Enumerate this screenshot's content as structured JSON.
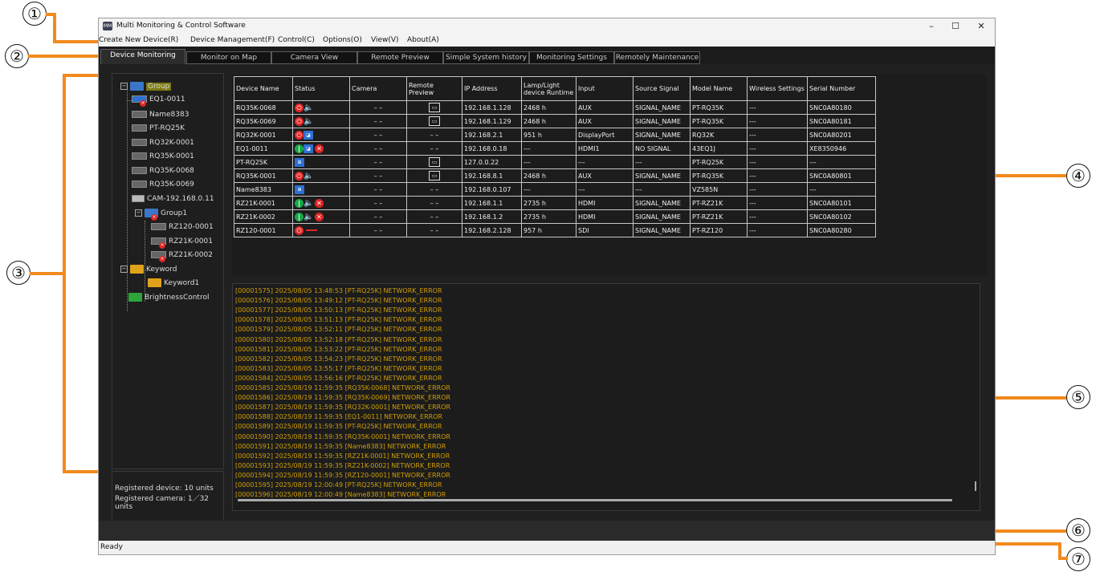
{
  "window": {
    "title": "Multi Monitoring & Control Software",
    "icon_text": "MM",
    "controls": [
      "–",
      "☐",
      "✕"
    ]
  },
  "menu": [
    "Create New Device(R)",
    "Device Management(F)",
    "Control(C)",
    "Options(O)",
    "View(V)",
    "About(A)"
  ],
  "tabs": [
    "Device Monitoring",
    "Monitor on Map",
    "Camera View",
    "Remote Preview",
    "Simple System history",
    "Monitoring Settings",
    "Remotely Maintenance"
  ],
  "callouts": [
    "①",
    "②",
    "③",
    "④",
    "⑤",
    "⑥",
    "⑦"
  ],
  "tree": {
    "root": "Group",
    "devices": [
      "EQ1-0011",
      "Name8383",
      "PT-RQ25K",
      "RQ32K-0001",
      "RQ35K-0001",
      "RQ35K-0068",
      "RQ35K-0069",
      "CAM-192.168.0.11"
    ],
    "group1": "Group1",
    "group1_devices": [
      "RZ120-0001",
      "RZ21K-0001",
      "RZ21K-0002"
    ],
    "keyword": "Keyword",
    "keyword1": "Keyword1",
    "brightness": "BrightnessControl"
  },
  "registration": {
    "line1": "Registered device: 10 units",
    "line2": "Registered camera: 1／32 units"
  },
  "table": {
    "headers": [
      "Device Name",
      "Status",
      "Camera",
      "Remote Preview",
      "IP Address",
      "Lamp/Light device Runtime",
      "Input",
      "Source Signal",
      "Model Name",
      "Wireless Settings",
      "Serial Number"
    ],
    "rows": [
      {
        "name": "RQ35K-0068",
        "status": "off-audio",
        "camera": "– –",
        "preview": true,
        "ip": "192.168.1.128",
        "runtime": "2468 h",
        "input": "AUX",
        "signal": "SIGNAL_NAME",
        "model": "PT-RQ35K",
        "wireless": "---",
        "serial": "SNC0A80180"
      },
      {
        "name": "RQ35K-0069",
        "status": "off-audio",
        "camera": "– –",
        "preview": true,
        "ip": "192.168.1.129",
        "runtime": "2468 h",
        "input": "AUX",
        "signal": "SIGNAL_NAME",
        "model": "PT-RQ35K",
        "wireless": "---",
        "serial": "SNC0A80181"
      },
      {
        "name": "RQ32K-0001",
        "status": "off-screen",
        "camera": "– –",
        "preview": false,
        "ip": "192.168.2.1",
        "runtime": "951 h",
        "input": "DisplayPort",
        "signal": "SIGNAL_NAME",
        "model": "RQ32K",
        "wireless": "---",
        "serial": "SNC0A80201"
      },
      {
        "name": "EQ1-0011",
        "status": "on-screen-error",
        "camera": "– –",
        "preview": false,
        "ip": "192.168.0.18",
        "runtime": "---",
        "input": "HDMI1",
        "signal": "NO SIGNAL",
        "model": "43EQ1J",
        "wireless": "---",
        "serial": "XE8350946"
      },
      {
        "name": "PT-RQ25K",
        "status": "network",
        "camera": "– –",
        "preview": true,
        "ip": "127.0.0.22",
        "runtime": "---",
        "input": "---",
        "signal": "---",
        "model": "PT-RQ25K",
        "wireless": "---",
        "serial": "---"
      },
      {
        "name": "RQ35K-0001",
        "status": "off-audio",
        "camera": "– –",
        "preview": true,
        "ip": "192.168.8.1",
        "runtime": "2468 h",
        "input": "AUX",
        "signal": "SIGNAL_NAME",
        "model": "PT-RQ35K",
        "wireless": "---",
        "serial": "SNC0A80801"
      },
      {
        "name": "Name8383",
        "status": "network",
        "camera": "– –",
        "preview": false,
        "ip": "192.168.0.107",
        "runtime": "---",
        "input": "---",
        "signal": "---",
        "model": "VZ585N",
        "wireless": "---",
        "serial": "---"
      },
      {
        "name": "RZ21K-0001",
        "status": "on-audio-error",
        "camera": "– –",
        "preview": false,
        "ip": "192.168.1.1",
        "runtime": "2735 h",
        "input": "HDMI",
        "signal": "SIGNAL_NAME",
        "model": "PT-RZ21K",
        "wireless": "---",
        "serial": "SNC0A80101"
      },
      {
        "name": "RZ21K-0002",
        "status": "on-audio-error",
        "camera": "– –",
        "preview": false,
        "ip": "192.168.1.2",
        "runtime": "2735 h",
        "input": "HDMI",
        "signal": "SIGNAL_NAME",
        "model": "PT-RZ21K",
        "wireless": "---",
        "serial": "SNC0A80102"
      },
      {
        "name": "RZ120-0001",
        "status": "off-dash",
        "camera": "– –",
        "preview": false,
        "ip": "192.168.2.128",
        "runtime": "957 h",
        "input": "SDI",
        "signal": "SIGNAL_NAME",
        "model": "PT-RZ120",
        "wireless": "---",
        "serial": "SNC0A80280"
      }
    ]
  },
  "log": [
    "[00001575] 2025/08/05 13:48:53 [PT-RQ25K] NETWORK_ERROR",
    "[00001576] 2025/08/05 13:49:12 [PT-RQ25K] NETWORK_ERROR",
    "[00001577] 2025/08/05 13:50:13 [PT-RQ25K] NETWORK_ERROR",
    "[00001578] 2025/08/05 13:51:13 [PT-RQ25K] NETWORK_ERROR",
    "[00001579] 2025/08/05 13:52:11 [PT-RQ25K] NETWORK_ERROR",
    "[00001580] 2025/08/05 13:52:18 [PT-RQ25K] NETWORK_ERROR",
    "[00001581] 2025/08/05 13:53:22 [PT-RQ25K] NETWORK_ERROR",
    "[00001582] 2025/08/05 13:54:23 [PT-RQ25K] NETWORK_ERROR",
    "[00001583] 2025/08/05 13:55:17 [PT-RQ25K] NETWORK_ERROR",
    "[00001584] 2025/08/05 13:56:16 [PT-RQ25K] NETWORK_ERROR",
    "[00001585] 2025/08/19 11:59:35 [RQ35K-0068] NETWORK_ERROR",
    "[00001586] 2025/08/19 11:59:35 [RQ35K-0069] NETWORK_ERROR",
    "[00001587] 2025/08/19 11:59:35 [RQ32K-0001] NETWORK_ERROR",
    "[00001588] 2025/08/19 11:59:35 [EQ1-0011] NETWORK_ERROR",
    "[00001589] 2025/08/19 11:59:35 [PT-RQ25K] NETWORK_ERROR",
    "[00001590] 2025/08/19 11:59:35 [RQ35K-0001] NETWORK_ERROR",
    "[00001591] 2025/08/19 11:59:35 [Name8383] NETWORK_ERROR",
    "[00001592] 2025/08/19 11:59:35 [RZ21K-0001] NETWORK_ERROR",
    "[00001593] 2025/08/19 11:59:35 [RZ21K-0002] NETWORK_ERROR",
    "[00001594] 2025/08/19 11:59:35 [RZ120-0001] NETWORK_ERROR",
    "[00001595] 2025/08/19 12:00:49 [PT-RQ25K] NETWORK_ERROR",
    "[00001596] 2025/08/19 12:00:49 [Name8383] NETWORK_ERROR"
  ],
  "status_bar": "Ready",
  "colors": {
    "accent": "#f28a1d",
    "log_text": "#d29f06",
    "power_off": "#e02424",
    "power_on": "#18a848"
  }
}
